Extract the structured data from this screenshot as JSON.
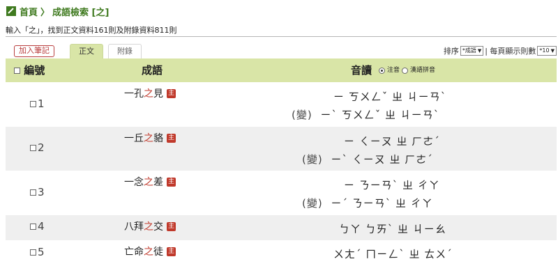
{
  "breadcrumb": {
    "home": "首頁",
    "separator": "〉",
    "current": "成語檢索 [之]"
  },
  "summary": "輸入「之」，找到正文資料161則及附錄資料811則",
  "toolbar": {
    "add_note": "加入筆記",
    "tab_main": "正文",
    "tab_appendix": "附錄",
    "sort_label": "排序",
    "sort_value": "*成語",
    "per_page_label": "| 每頁顯示則數",
    "per_page_value": "*10"
  },
  "table": {
    "col_num": "編號",
    "col_idiom": "成語",
    "col_pron": "音讀",
    "radio_zhuyin": "注音",
    "radio_pinyin": "漢語拼音",
    "badge": "主",
    "zhi": "之",
    "rows": [
      {
        "num": "1",
        "pre": "一孔",
        "post": "見",
        "pron": [
          "ㄧ ㄎㄨㄥˇ ㄓ ㄐㄧㄢˋ",
          "ㄧˋ ㄎㄨㄥˇ ㄓ ㄐㄧㄢˋ"
        ],
        "variant": "(變)"
      },
      {
        "num": "2",
        "pre": "一丘",
        "post": "貉",
        "pron": [
          "ㄧ ㄑㄧㄡ ㄓ ㄏㄜˊ",
          "ㄧˋ ㄑㄧㄡ ㄓ ㄏㄜˊ"
        ],
        "variant": "(變)"
      },
      {
        "num": "3",
        "pre": "一念",
        "post": "差",
        "pron": [
          "ㄧ ㄋㄧㄢˋ ㄓ ㄔㄚ",
          "ㄧˊ ㄋㄧㄢˋ ㄓ ㄔㄚ"
        ],
        "variant": "(變)"
      },
      {
        "num": "4",
        "pre": "八拜",
        "post": "交",
        "pron": [
          "ㄅㄚ ㄅㄞˋ ㄓ ㄐㄧㄠ"
        ]
      },
      {
        "num": "5",
        "pre": "亡命",
        "post": "徒",
        "pron": [
          "ㄨㄤˊ ㄇㄧㄥˋ ㄓ ㄊㄨˊ"
        ]
      }
    ]
  }
}
